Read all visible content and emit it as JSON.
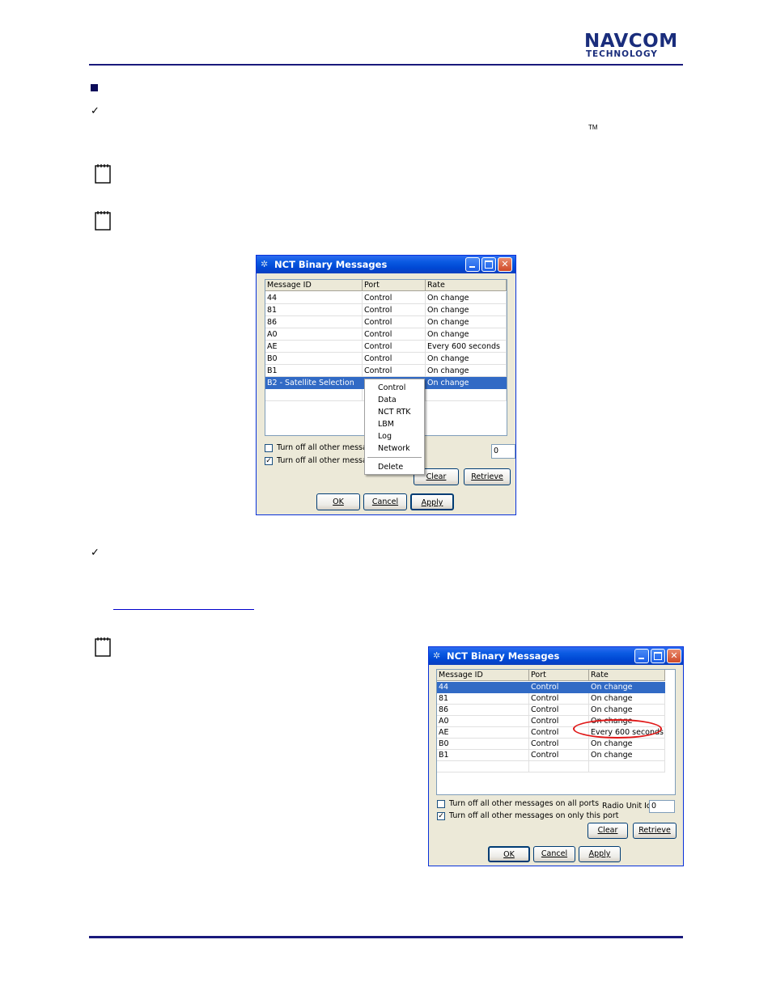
{
  "header": {
    "logo_top": "NAVCOM",
    "logo_bottom": "TECHNOLOGY"
  },
  "body": {
    "tm_mark": "TM"
  },
  "dialog1": {
    "title": "NCT Binary Messages",
    "columns": [
      "Message ID",
      "Port",
      "Rate"
    ],
    "rows": [
      [
        "44",
        "Control",
        "On change"
      ],
      [
        "81",
        "Control",
        "On change"
      ],
      [
        "86",
        "Control",
        "On change"
      ],
      [
        "A0",
        "Control",
        "On change"
      ],
      [
        "AE",
        "Control",
        "Every 600 seconds"
      ],
      [
        "B0",
        "Control",
        "On change"
      ],
      [
        "B1",
        "Control",
        "On change"
      ],
      [
        "B2 - Satellite Selection",
        "",
        "On change"
      ]
    ],
    "checkbox_all_ports": "Turn off all other message",
    "checkbox_this_port": "Turn off all other message",
    "radio_unit_value": "0",
    "buttons": {
      "clear": "Clear",
      "retrieve": "Retrieve",
      "ok": "OK",
      "cancel": "Cancel",
      "apply": "Apply"
    },
    "context_menu": [
      "Control",
      "Data",
      "NCT RTK",
      "LBM",
      "Log",
      "Network",
      "Delete"
    ]
  },
  "dialog2": {
    "title": "NCT Binary Messages",
    "columns": [
      "Message ID",
      "Port",
      "Rate"
    ],
    "rows": [
      [
        "44",
        "Control",
        "On change"
      ],
      [
        "81",
        "Control",
        "On change"
      ],
      [
        "86",
        "Control",
        "On change"
      ],
      [
        "A0",
        "Control",
        "On change"
      ],
      [
        "AE",
        "Control",
        "Every 600 seconds"
      ],
      [
        "B0",
        "Control",
        "On change"
      ],
      [
        "B1",
        "Control",
        "On change"
      ]
    ],
    "checkbox_all_ports": "Turn off all other messages on all ports",
    "checkbox_this_port": "Turn off all other messages on only this port",
    "radio_unit_label": "Radio Unit Id:",
    "radio_unit_value": "0",
    "buttons": {
      "clear": "Clear",
      "retrieve": "Retrieve",
      "ok": "OK",
      "cancel": "Cancel",
      "apply": "Apply"
    }
  },
  "colors": {
    "brand": "#1a2d7c",
    "selection": "#316ac5",
    "highlight_circle": "#e01818"
  }
}
